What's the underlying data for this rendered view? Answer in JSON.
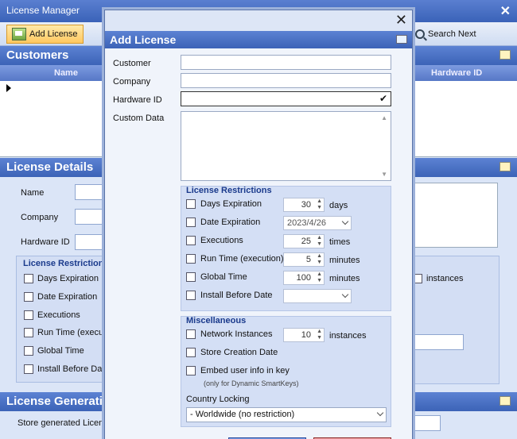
{
  "app": {
    "title": "License Manager"
  },
  "toolbar": {
    "add_license": "Add License",
    "search_next": "Search Next"
  },
  "customers": {
    "title": "Customers",
    "columns": [
      "Name",
      "Hardware ID"
    ]
  },
  "license_details": {
    "title": "License Details",
    "labels": [
      "Name",
      "Company",
      "Hardware ID"
    ],
    "restrictions_title": "License Restrictions",
    "restrictions": [
      "Days Expiration",
      "Date Expiration",
      "Executions",
      "Run Time (executi",
      "Global Time",
      "Install Before Date"
    ],
    "instances_label": "instances"
  },
  "license_generation": {
    "title": "License Generatio",
    "store_label": "Store generated License"
  },
  "dialog": {
    "title": "Add License",
    "fields": {
      "customer": {
        "label": "Customer",
        "value": ""
      },
      "company": {
        "label": "Company",
        "value": ""
      },
      "hardware_id": {
        "label": "Hardware ID",
        "value": ""
      },
      "custom_data": {
        "label": "Custom Data",
        "value": ""
      }
    },
    "restrictions": {
      "title": "License Restrictions",
      "days_expiration": {
        "label": "Days Expiration",
        "value": "30",
        "unit": "days",
        "checked": false
      },
      "date_expiration": {
        "label": "Date Expiration",
        "value": "2023/4/26",
        "checked": false
      },
      "executions": {
        "label": "Executions",
        "value": "25",
        "unit": "times",
        "checked": false
      },
      "run_time": {
        "label": "Run Time (execution)",
        "value": "5",
        "unit": "minutes",
        "checked": false
      },
      "global_time": {
        "label": "Global Time",
        "value": "100",
        "unit": "minutes",
        "checked": false
      },
      "install_before": {
        "label": "Install Before Date",
        "value": "",
        "checked": false
      }
    },
    "misc": {
      "title": "Miscellaneous",
      "network_instances": {
        "label": "Network Instances",
        "value": "10",
        "unit": "instances",
        "checked": false
      },
      "store_creation": {
        "label": "Store Creation Date",
        "checked": false
      },
      "embed_user": {
        "label": "Embed user info in key",
        "note": "(only for Dynamic SmartKeys)",
        "checked": false
      },
      "country_locking": {
        "label": "Country Locking",
        "value": "- Worldwide (no restriction)"
      }
    }
  }
}
